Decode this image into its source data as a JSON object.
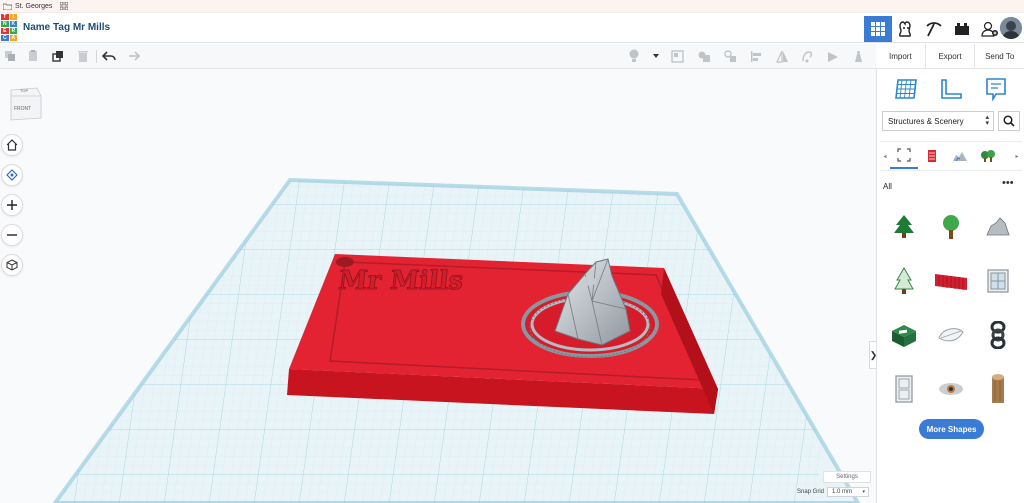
{
  "bookmarks": {
    "item1": "St. Georges"
  },
  "logo_letters": [
    "T",
    "I",
    "N",
    "K",
    "E",
    "R",
    "C",
    "A",
    "D"
  ],
  "document": {
    "title": "Name Tag Mr Mills"
  },
  "actions": {
    "import": "Import",
    "export": "Export",
    "send_to": "Send To"
  },
  "viewcube": {
    "top": "TOP",
    "front": "FRONT"
  },
  "scene": {
    "nametag_text": "Mr Mills"
  },
  "workplane": {
    "settings_label": "Settings",
    "snap_label": "Snap Grid",
    "snap_value": "1.0 mm"
  },
  "library": {
    "category": "Structures & Scenery",
    "filter_label": "All",
    "more_button": "More Shapes"
  },
  "colors": {
    "accent": "#3a7bd5",
    "tag_red": "#e01b2a",
    "grid": "#bfe1ec"
  },
  "icons": [
    "grid-view-icon",
    "blocks-icon",
    "pickaxe-icon",
    "bricks-icon",
    "add-user-icon",
    "copy-icon",
    "paste-icon",
    "duplicate-icon",
    "trash-icon",
    "undo-icon",
    "redo-icon",
    "light-icon",
    "group-icon",
    "ungroup-icon",
    "align-icon",
    "mirror-icon",
    "home-icon",
    "fit-icon",
    "zoom-in-icon",
    "zoom-out-icon",
    "orthographic-icon",
    "search-icon"
  ]
}
